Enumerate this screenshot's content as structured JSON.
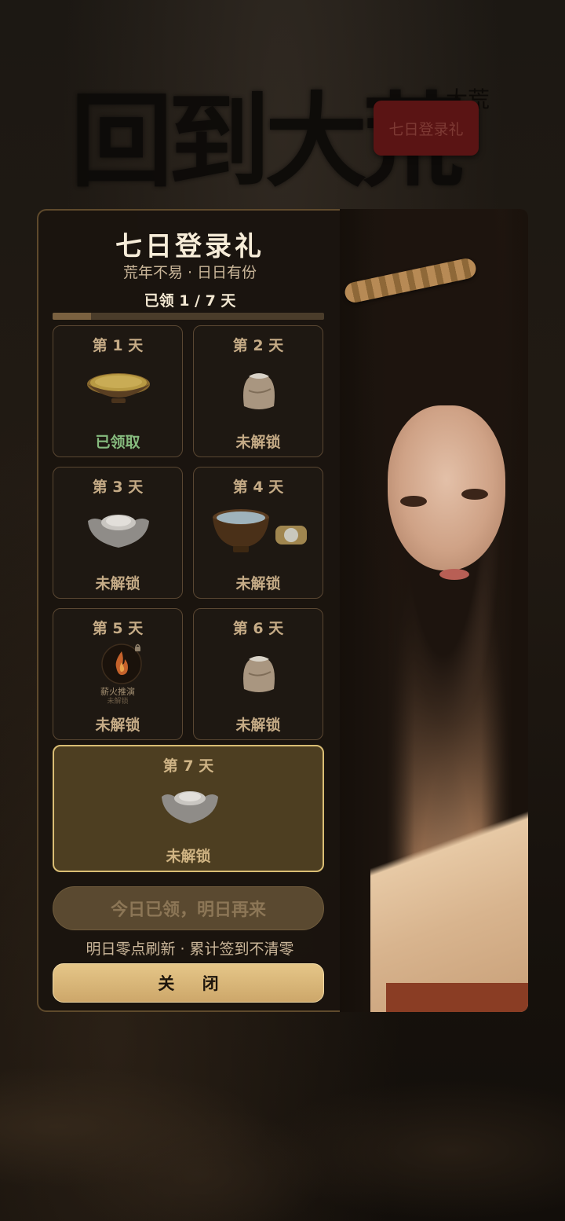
{
  "background": {
    "calligraphy_title": "回到大荒",
    "small_text": "大荒",
    "badge_label": "七日登录礼"
  },
  "dialog": {
    "title": "七日登录礼",
    "subtitle": "荒年不易 · 日日有份",
    "progress_text": "已领 1 / 7 天",
    "progress": {
      "claimed": 1,
      "total": 7
    },
    "days": [
      {
        "label": "第 1 天",
        "status": "已领取",
        "claimed": true,
        "item_icon": "grain-bowl-icon"
      },
      {
        "label": "第 2 天",
        "status": "未解锁",
        "claimed": false,
        "item_icon": "grain-sack-icon"
      },
      {
        "label": "第 3 天",
        "status": "未解锁",
        "claimed": false,
        "item_icon": "silver-ingot-icon"
      },
      {
        "label": "第 4 天",
        "status": "未解锁",
        "claimed": false,
        "item_icon": "water-bowl-and-jade-icon"
      },
      {
        "label": "第 5 天",
        "status": "未解锁",
        "claimed": false,
        "item_icon": "fire-skill-locked-icon",
        "item_caption": "薪火推演",
        "item_subcaption": "未解锁"
      },
      {
        "label": "第 6 天",
        "status": "未解锁",
        "claimed": false,
        "item_icon": "grain-sack-icon"
      },
      {
        "label": "第 7 天",
        "status": "未解锁",
        "claimed": false,
        "item_icon": "silver-ingot-icon"
      }
    ],
    "claim_button_label": "今日已领，明日再来",
    "refresh_note": "明日零点刷新 · 累计签到不清零",
    "close_button_label": "关 闭"
  },
  "colors": {
    "claimed_status": "#86bb7e",
    "locked_status": "#c5ab86",
    "gold_accent": "#d9bd74",
    "close_button": "#dcbb7c"
  }
}
